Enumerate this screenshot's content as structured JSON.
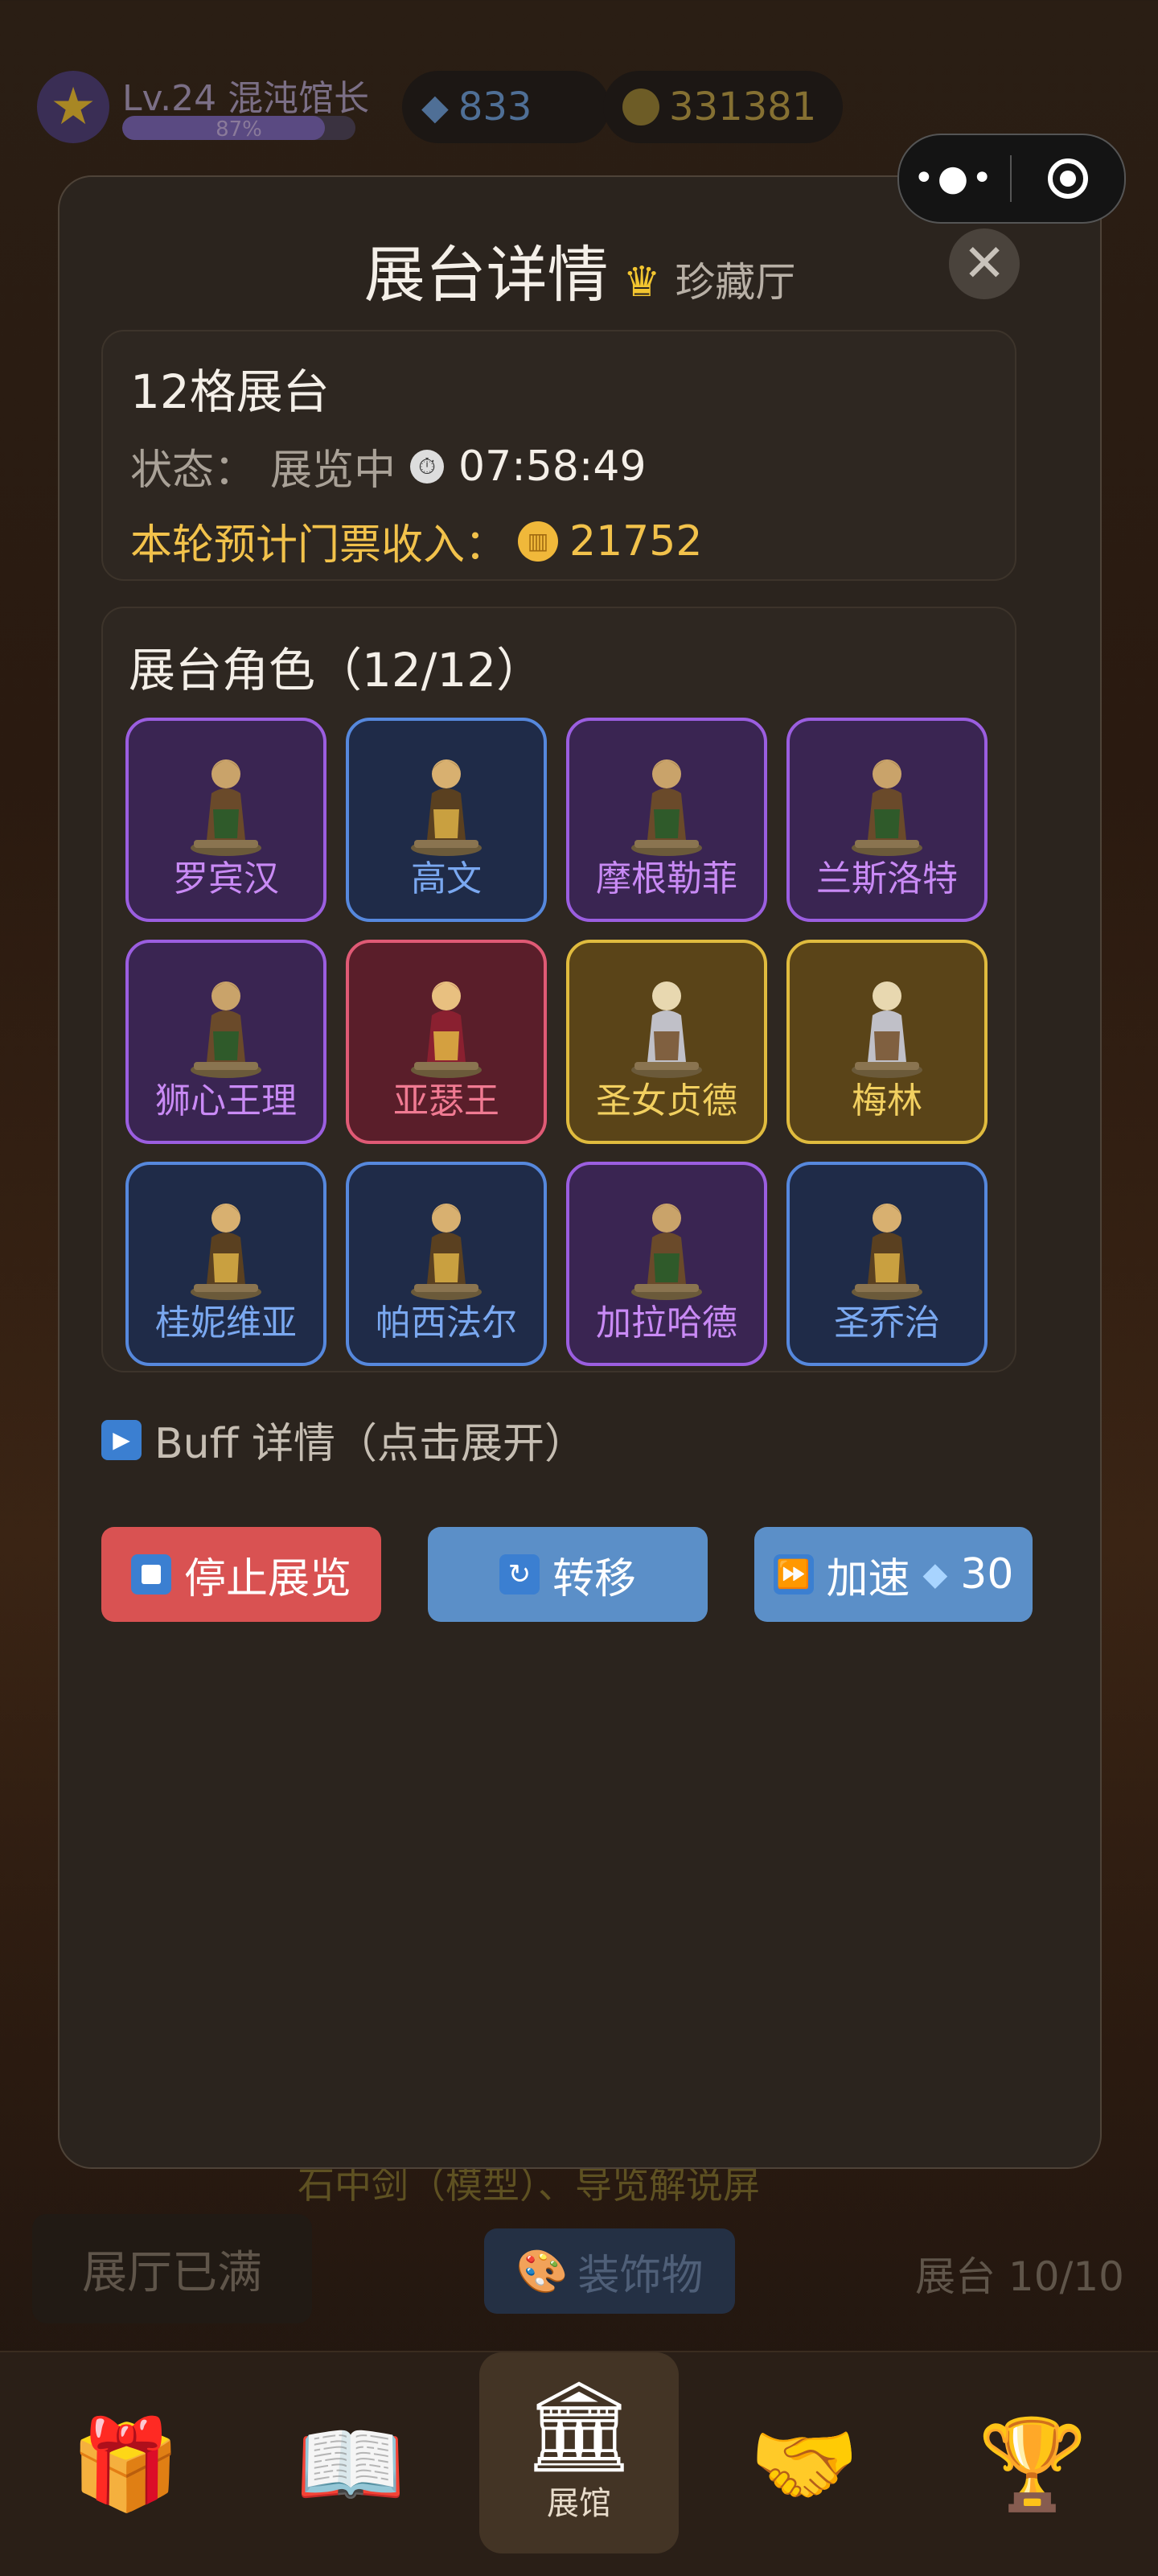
{
  "background": {
    "level_text": "Lv.24 混沌馆长",
    "level_progress": "87%",
    "level_fraction": 0.87,
    "gems": "833",
    "coins": "331381",
    "ghost_text": "石中剑（模型）、导览解说屏",
    "hall_full": "展厅已满",
    "decor_button": "装饰物",
    "stage_count": "展台 10/10"
  },
  "modal": {
    "title": "展台详情",
    "subtitle": "珍藏厅",
    "info": {
      "name": "12格展台",
      "status_label": "状态：",
      "status_value": "展览中",
      "timer": "07:58:49",
      "income_label": "本轮预计门票收入：",
      "income_value": "21752"
    },
    "characters": {
      "title": "展台角色（12/12）",
      "items": [
        {
          "name": "罗宾汉",
          "rarity": "purple"
        },
        {
          "name": "高文",
          "rarity": "blue"
        },
        {
          "name": "摩根勒菲",
          "rarity": "purple"
        },
        {
          "name": "兰斯洛特",
          "rarity": "purple"
        },
        {
          "name": "狮心王理",
          "rarity": "purple"
        },
        {
          "name": "亚瑟王",
          "rarity": "red"
        },
        {
          "name": "圣女贞德",
          "rarity": "gold"
        },
        {
          "name": "梅林",
          "rarity": "gold"
        },
        {
          "name": "桂妮维亚",
          "rarity": "blue"
        },
        {
          "name": "帕西法尔",
          "rarity": "blue"
        },
        {
          "name": "加拉哈德",
          "rarity": "purple"
        },
        {
          "name": "圣乔治",
          "rarity": "blue"
        }
      ]
    },
    "buff_text": "Buff 详情（点击展开）",
    "actions": {
      "stop": "停止展览",
      "move": "转移",
      "speed": "加速",
      "speed_cost": "30"
    }
  },
  "nav": {
    "active_label": "展馆"
  },
  "colors": {
    "purple": "#9b5ee0",
    "blue": "#5688dd",
    "red": "#e05a75",
    "gold": "#e0bb3e",
    "stop_button": "#d95252",
    "action_button": "#5b8fc8",
    "income": "#f2c24b"
  }
}
